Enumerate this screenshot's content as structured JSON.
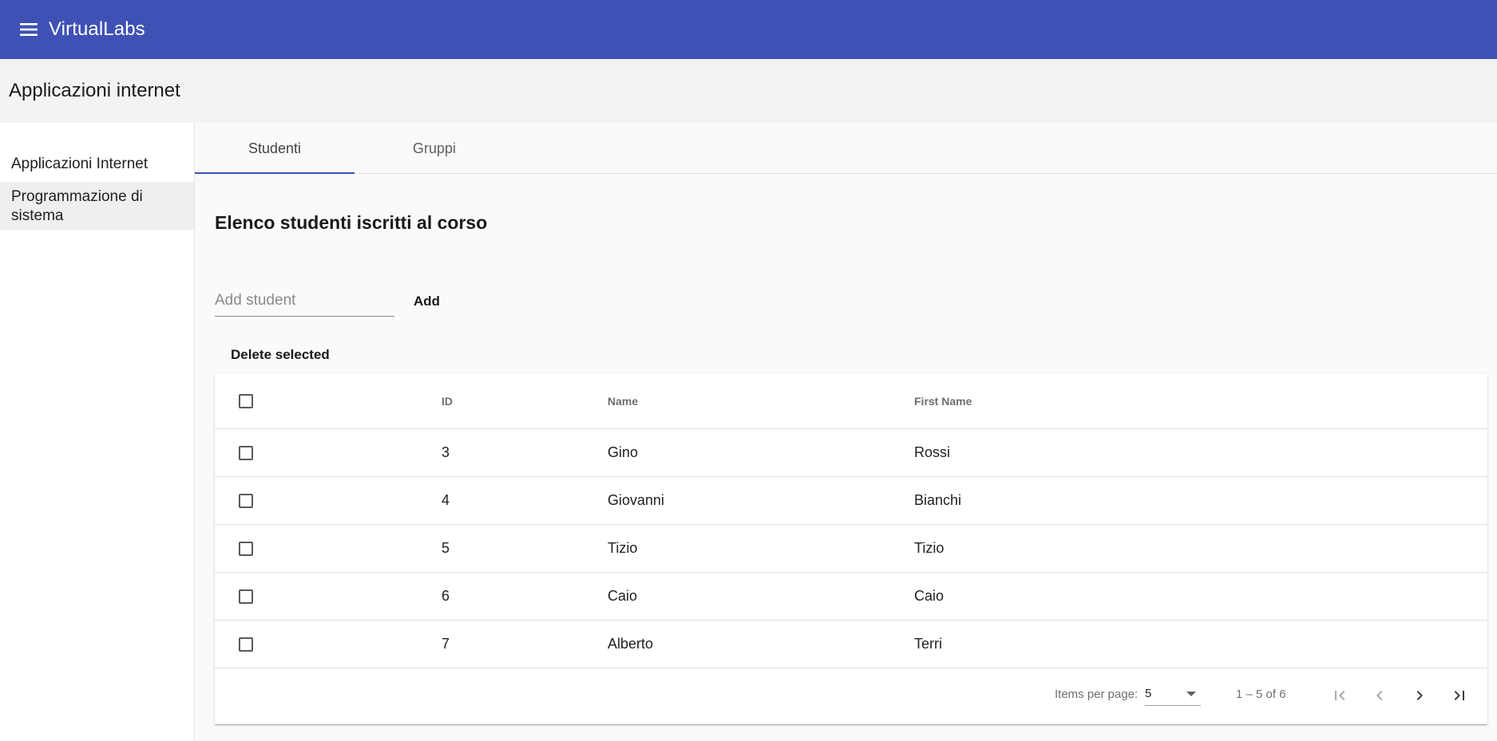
{
  "toolbar": {
    "app_title": "VirtualLabs",
    "menu_icon": "menu-icon",
    "color": "#3f51b5"
  },
  "course": {
    "title": "Applicazioni internet"
  },
  "sidebar": {
    "items": [
      {
        "label": "Applicazioni Internet",
        "selected": false
      },
      {
        "label": "Programmazione di sistema",
        "selected": true
      }
    ]
  },
  "tabs": [
    {
      "label": "Studenti",
      "active": true
    },
    {
      "label": "Gruppi",
      "active": false
    }
  ],
  "students": {
    "section_title": "Elenco studenti iscritti al corso",
    "add_placeholder": "Add student",
    "add_value": "",
    "add_label": "Add",
    "delete_label": "Delete selected",
    "columns": [
      "ID",
      "Name",
      "First Name"
    ],
    "rows": [
      {
        "id": "3",
        "name": "Gino",
        "first_name": "Rossi",
        "checked": false
      },
      {
        "id": "4",
        "name": "Giovanni",
        "first_name": "Bianchi",
        "checked": false
      },
      {
        "id": "5",
        "name": "Tizio",
        "first_name": "Tizio",
        "checked": false
      },
      {
        "id": "6",
        "name": "Caio",
        "first_name": "Caio",
        "checked": false
      },
      {
        "id": "7",
        "name": "Alberto",
        "first_name": "Terri",
        "checked": false
      }
    ]
  },
  "paginator": {
    "items_per_page_label": "Items per page:",
    "page_size": "5",
    "range_label": "1 – 5 of 6",
    "icons": [
      "first-page-icon",
      "previous-page-icon",
      "next-page-icon",
      "last-page-icon"
    ]
  }
}
